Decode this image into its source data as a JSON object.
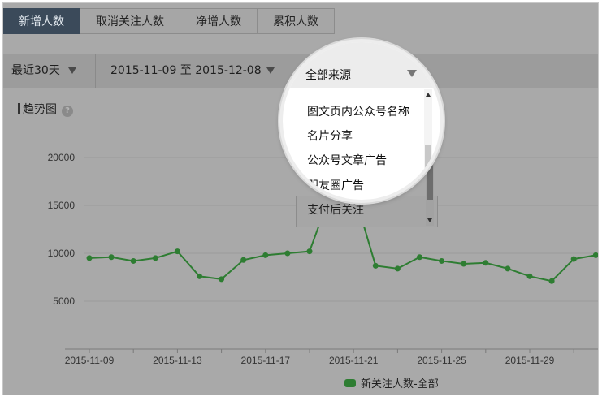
{
  "tabs": [
    {
      "label": "新增人数",
      "active": true
    },
    {
      "label": "取消关注人数",
      "active": false
    },
    {
      "label": "净增人数",
      "active": false
    },
    {
      "label": "累积人数",
      "active": false
    }
  ],
  "filters": {
    "period": "最近30天",
    "date_range": "2015-11-09 至 2015-12-08",
    "source": "全部来源"
  },
  "dropdown": {
    "options": [
      "图文页内公众号名称",
      "名片分享",
      "公众号文章广告",
      "朋友圈广告",
      "支付后关注"
    ]
  },
  "trend": {
    "title": "趋势图",
    "help": "?"
  },
  "colors": {
    "line": "#2e7d32",
    "active_tab": "#3b4a5a"
  },
  "chart_data": {
    "type": "line",
    "x": [
      "2015-11-09",
      "2015-11-10",
      "2015-11-11",
      "2015-11-12",
      "2015-11-13",
      "2015-11-14",
      "2015-11-15",
      "2015-11-16",
      "2015-11-17",
      "2015-11-18",
      "2015-11-19",
      "2015-11-20",
      "2015-11-21",
      "2015-11-22",
      "2015-11-23",
      "2015-11-24",
      "2015-11-25",
      "2015-11-26",
      "2015-11-27",
      "2015-11-28",
      "2015-11-29",
      "2015-11-30",
      "2015-12-01",
      "2015-12-02"
    ],
    "x_tick_labels": [
      "2015-11-09",
      "2015-11-13",
      "2015-11-17",
      "2015-11-21",
      "2015-11-25",
      "2015-11-29"
    ],
    "y_ticks": [
      5000,
      10000,
      15000,
      20000
    ],
    "ylim": [
      0,
      22500
    ],
    "grid": true,
    "legend_position": "bottom-center",
    "series": [
      {
        "name": "新关注人数-全部",
        "values": [
          9500,
          9600,
          9200,
          9500,
          10200,
          7600,
          7300,
          9300,
          9800,
          10000,
          10200,
          16500,
          16500,
          8700,
          8400,
          9600,
          9200,
          8900,
          9000,
          8400,
          7600,
          7100,
          9400,
          9800
        ]
      }
    ]
  }
}
